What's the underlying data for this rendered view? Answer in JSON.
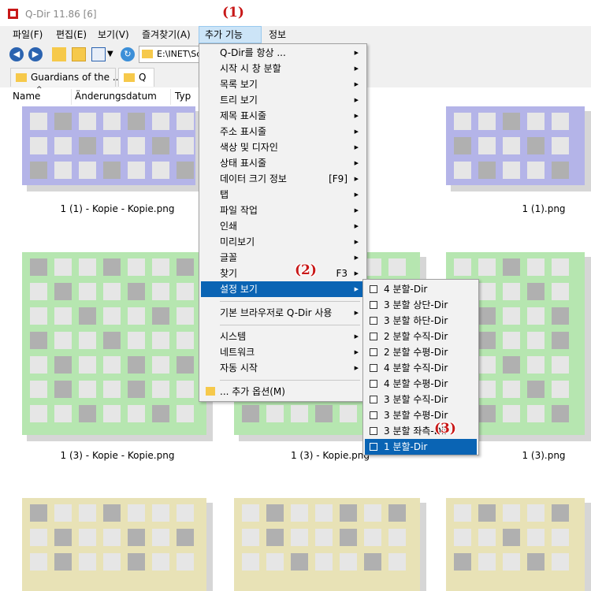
{
  "window": {
    "title": "Q-Dir 11.86 [6]"
  },
  "menubar": {
    "items": [
      "파일(F)",
      "편집(E)",
      "보기(V)",
      "즐겨찾기(A)",
      "추가 기능(X)",
      "정보"
    ]
  },
  "address": {
    "path": "E:\\INET\\Sc"
  },
  "tabs": [
    {
      "label": "Guardians of the ..."
    },
    {
      "label": "Q"
    }
  ],
  "columns": {
    "name": "Name",
    "date": "Änderungsdatum",
    "type": "Typ"
  },
  "files": [
    {
      "caption": "1 (1) - Kopie - Kopie.png"
    },
    {
      "caption": "1 (1).png"
    },
    {
      "caption": "1 (3) - Kopie - Kopie.png"
    },
    {
      "caption": "1 (3) - Kopie.png"
    },
    {
      "caption": "1 (3).png"
    }
  ],
  "thumb_colors": {
    "purple": "#b4b4e8",
    "green": "#b6e6b0",
    "yellow": "#e8e2b6",
    "cell_light": "#e6e6e6",
    "cell_dark": "#b0b0b0"
  },
  "dropdown": {
    "items": [
      {
        "label": "Q-Dir를 항상 ...",
        "shortcut": ""
      },
      {
        "label": "시작 시 창 분할",
        "shortcut": ""
      },
      {
        "label": "목록 보기",
        "shortcut": ""
      },
      {
        "label": "트리 보기",
        "shortcut": ""
      },
      {
        "label": "제목 표시줄",
        "shortcut": ""
      },
      {
        "label": "주소 표시줄",
        "shortcut": ""
      },
      {
        "label": "색상 및 디자인",
        "shortcut": ""
      },
      {
        "label": "상태 표시줄",
        "shortcut": ""
      },
      {
        "label": "데이터 크기 정보",
        "shortcut": "[F9]"
      },
      {
        "label": "탭",
        "shortcut": ""
      },
      {
        "label": "파일 작업",
        "shortcut": ""
      },
      {
        "label": "인쇄",
        "shortcut": ""
      },
      {
        "label": "미리보기",
        "shortcut": ""
      },
      {
        "label": "글꼴",
        "shortcut": ""
      },
      {
        "label": "찾기",
        "shortcut": "F3"
      },
      {
        "label": "설정 보기",
        "shortcut": ""
      },
      {
        "label": "기본 브라우저로 Q-Dir 사용",
        "shortcut": ""
      },
      {
        "label": "시스템",
        "shortcut": ""
      },
      {
        "label": "네트워크",
        "shortcut": ""
      },
      {
        "label": "자동 시작",
        "shortcut": ""
      },
      {
        "label": "... 추가 옵션(M)",
        "shortcut": ""
      }
    ]
  },
  "submenu": {
    "items": [
      {
        "label": "4 분할-Dir"
      },
      {
        "label": "3 분할 상단-Dir"
      },
      {
        "label": "3 분할 하단-Dir"
      },
      {
        "label": "2 분할 수직-Dir"
      },
      {
        "label": "2 분할 수평-Dir"
      },
      {
        "label": "4 분할 수직-Dir"
      },
      {
        "label": "4 분할 수평-Dir"
      },
      {
        "label": "3 분할 수직-Dir"
      },
      {
        "label": "3 분할 수평-Dir"
      },
      {
        "label": "3 분할 좌측-Dir"
      },
      {
        "label": "1 분할-Dir"
      }
    ]
  },
  "steps": [
    "(1)",
    "(2)",
    "(3)"
  ]
}
